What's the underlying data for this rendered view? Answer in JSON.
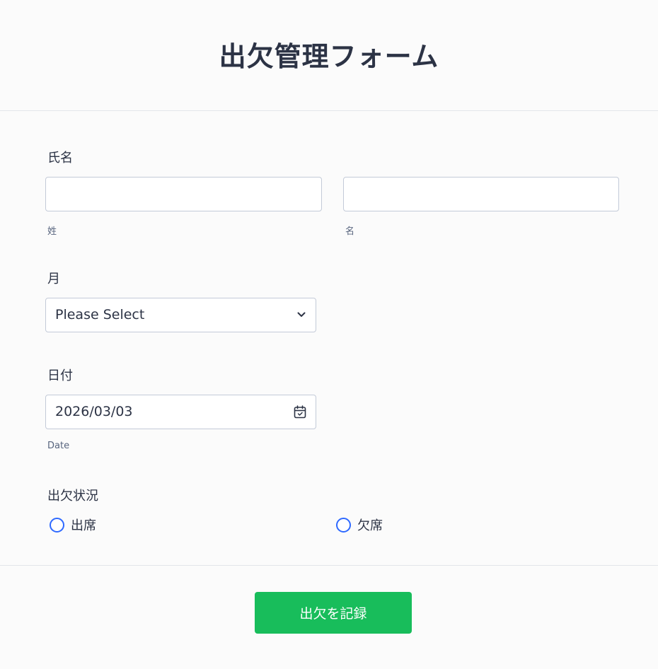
{
  "form": {
    "title": "出欠管理フォーム",
    "name_field": {
      "label": "氏名",
      "last_value": "",
      "first_value": "",
      "last_sublabel": "姓",
      "first_sublabel": "名"
    },
    "month_field": {
      "label": "月",
      "selected": "Please Select",
      "icon": "chevron-down-icon"
    },
    "date_field": {
      "label": "日付",
      "value": "2026/03/03",
      "sublabel": "Date",
      "icon": "calendar-icon"
    },
    "attendance_field": {
      "label": "出欠状況",
      "options": [
        "出席",
        "欠席"
      ],
      "selected": null
    },
    "submit_label": "出欠を記録"
  },
  "colors": {
    "accent": "#2e69ff",
    "submit": "#18bd5b",
    "text": "#2c3345",
    "border": "#c3cad8"
  }
}
